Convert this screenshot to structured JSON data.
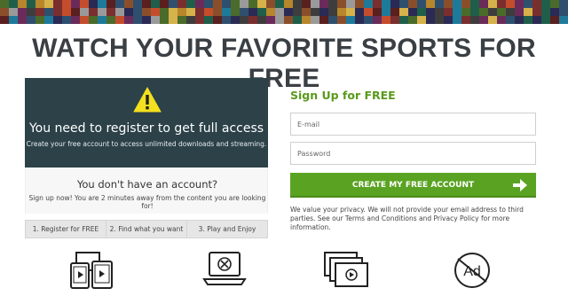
{
  "title": "WATCH YOUR FAVORITE SPORTS FOR FREE",
  "notice": {
    "heading": "You need to register to get full access",
    "text": "Create your free account to access unlimited downloads and streaming.",
    "icon": "warning-icon"
  },
  "account": {
    "heading": "You don't have an account?",
    "text": "Sign up now! You are 2 minutes away from the content you are looking for!"
  },
  "steps": [
    "1. Register for FREE",
    "2. Find what you want",
    "3. Play and Enjoy"
  ],
  "signup": {
    "heading": "Sign Up for FREE",
    "email_placeholder": "E-mail",
    "password_placeholder": "Password",
    "button_label": "CREATE MY FREE ACCOUNT",
    "privacy": "We value your privacy. We will not provide your email address to third parties. See our Terms and Conditions and Privacy Policy for more information."
  },
  "features": [
    {
      "icon": "devices-icon"
    },
    {
      "icon": "laptop-no-download-icon"
    },
    {
      "icon": "media-library-icon"
    },
    {
      "icon": "no-ads-icon"
    }
  ],
  "colors": {
    "accent": "#5aa322",
    "dark_panel": "#2c4148",
    "heading_green": "#5a9a1c"
  }
}
